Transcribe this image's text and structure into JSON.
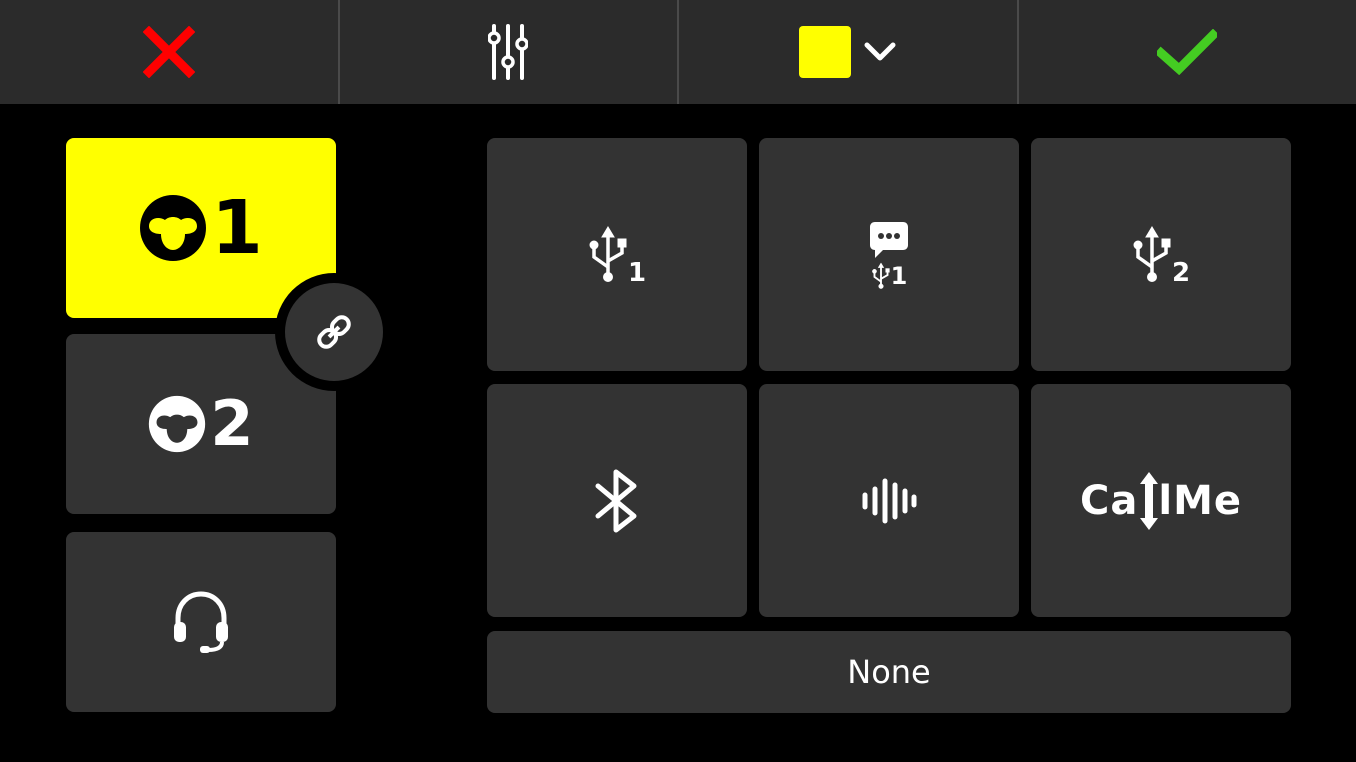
{
  "toolbar": {
    "cancel_icon": "close-icon",
    "settings_icon": "sliders-icon",
    "color_dropdown": {
      "selected_color": "#ffff00",
      "icon": "chevron-down-icon"
    },
    "confirm_icon": "checkmark-icon"
  },
  "colors": {
    "cancel": "#ff0000",
    "confirm": "#44cc22",
    "active_tile": "#ffff00",
    "tile": "#333333",
    "toolbar": "#2b2b2b"
  },
  "sources": {
    "source1": {
      "icon": "monkey-icon",
      "number": "1",
      "selected": true
    },
    "source2": {
      "icon": "monkey-icon",
      "number": "2",
      "selected": false
    },
    "headset": {
      "icon": "headset-icon"
    }
  },
  "link": {
    "icon": "link-icon"
  },
  "outputs": {
    "usb1": {
      "icon": "usb-icon",
      "sub": "1"
    },
    "usb1_chat": {
      "icon": "chat-usb-icon",
      "sub": "1"
    },
    "usb2": {
      "icon": "usb-icon",
      "sub": "2"
    },
    "bluetooth": {
      "icon": "bluetooth-icon"
    },
    "audio": {
      "icon": "waveform-icon"
    },
    "callme": {
      "label_left": "Ca",
      "label_right": "Me"
    },
    "none": {
      "label": "None"
    }
  }
}
